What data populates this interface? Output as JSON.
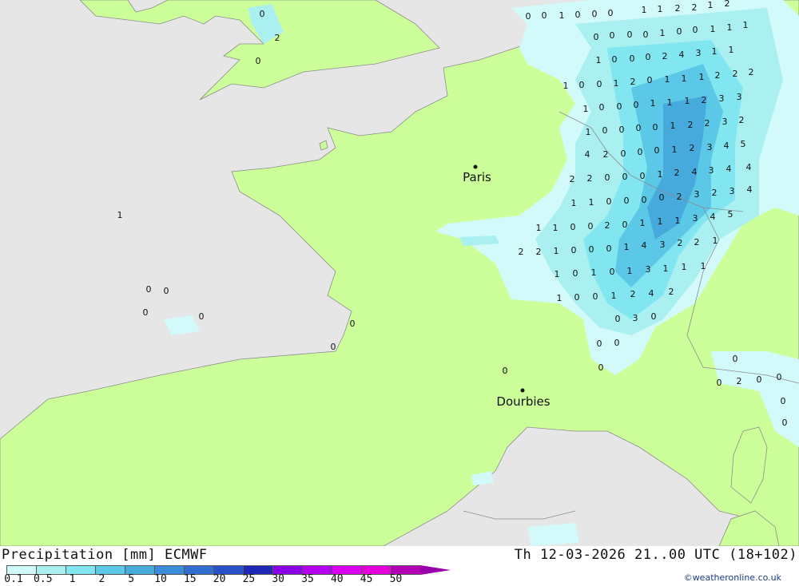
{
  "header": {
    "title": "Precipitation [mm] ECMWF",
    "timestamp": "Th 12-03-2026 21..00 UTC (18+102)",
    "credit": "©weatheronline.co.uk"
  },
  "cities": [
    {
      "name": "Paris"
    },
    {
      "name": "Dourbies"
    }
  ],
  "legend": {
    "ticks": [
      "0.1",
      "0.5",
      "1",
      "2",
      "5",
      "10",
      "15",
      "20",
      "25",
      "30",
      "35",
      "40",
      "45",
      "50"
    ],
    "colors": [
      "#d2fafa",
      "#aaf0f0",
      "#82e6f0",
      "#5ac8e6",
      "#46aadc",
      "#3c8cdc",
      "#326ed2",
      "#2850c8",
      "#1e28b4",
      "#8c00e6",
      "#b400f0",
      "#dc00f0",
      "#e600dc",
      "#b400b4"
    ]
  },
  "map": {
    "land_color": "#ccff99",
    "sea_color": "#e6e6e6",
    "precip_colors": [
      "#d2fafa",
      "#aaf0f0",
      "#82e6f0",
      "#5ac8e6",
      "#46aadc"
    ],
    "labels": [
      "0",
      "0",
      "1",
      "0",
      "0",
      "0",
      "1",
      "1",
      "2",
      "2",
      "1",
      "2",
      "0",
      "0",
      "0",
      "0",
      "1",
      "0",
      "0",
      "1",
      "1",
      "1",
      "1",
      "0",
      "0",
      "0",
      "2",
      "4",
      "3",
      "1",
      "1",
      "1",
      "0",
      "0",
      "1",
      "2",
      "0",
      "1",
      "1",
      "1",
      "2",
      "2",
      "2",
      "1",
      "0",
      "0",
      "0",
      "1",
      "1",
      "1",
      "2",
      "3",
      "3",
      "1",
      "0",
      "0",
      "0",
      "0",
      "1",
      "2",
      "2",
      "3",
      "2",
      "4",
      "2",
      "0",
      "0",
      "0",
      "1",
      "2",
      "3",
      "4",
      "5",
      "2",
      "2",
      "0",
      "0",
      "0",
      "1",
      "2",
      "4",
      "3",
      "4",
      "4",
      "1",
      "1",
      "0",
      "0",
      "0",
      "0",
      "2",
      "3",
      "2",
      "3",
      "4",
      "1",
      "1",
      "0",
      "0",
      "2",
      "0",
      "1",
      "1",
      "1",
      "3",
      "4",
      "5",
      "2",
      "2",
      "1",
      "0",
      "0",
      "0",
      "1",
      "4",
      "3",
      "2",
      "2",
      "1",
      "1",
      "0",
      "1",
      "0",
      "1",
      "3",
      "1",
      "1",
      "1",
      "1",
      "0",
      "0",
      "1",
      "2",
      "4",
      "2",
      "0",
      "3",
      "0",
      "0",
      "0",
      "0",
      "1",
      "0",
      "0",
      "0",
      "0",
      "0",
      "0",
      "0",
      "0",
      "0",
      "2",
      "0",
      "0",
      "0",
      "0",
      "0",
      "2",
      "0"
    ]
  }
}
